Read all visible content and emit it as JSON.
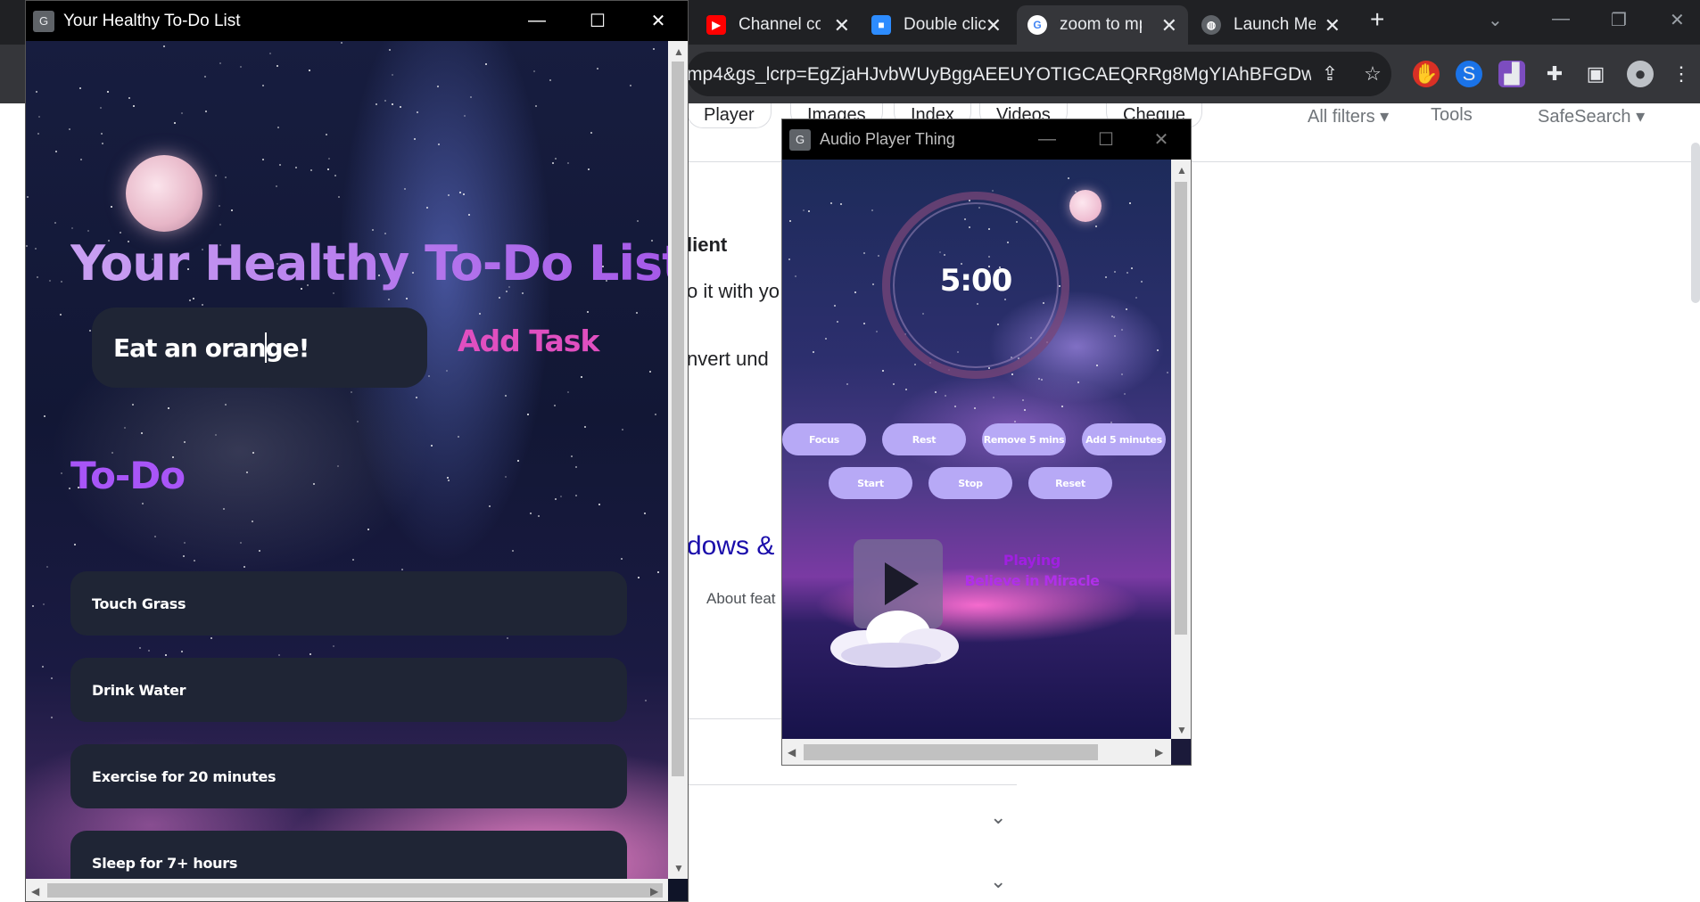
{
  "browser": {
    "tabs": [
      {
        "title": "Channel co",
        "icon": "youtube-icon",
        "color": "#ff0000"
      },
      {
        "title": "Double clic",
        "icon": "zoom-icon",
        "color": "#2d8cff"
      },
      {
        "title": "zoom to mp",
        "icon": "google-icon",
        "color": "#ffffff"
      },
      {
        "title": "Launch Med",
        "icon": "globe-icon",
        "color": "#9aa0a6"
      }
    ],
    "new_tab": "+",
    "address": "mp4&gs_lcrp=EgZjaHJvbWUyBggAEEUYOTIGCAEQRRg8MgYIAhBFGDwy...",
    "filters": [
      "Player",
      "Images",
      "Index",
      "Videos",
      "Cheque"
    ],
    "all_filters": "All filters",
    "tools": "Tools",
    "safesearch": "SafeSearch",
    "bg_snippets": {
      "line1": "lient",
      "line2": "o it with yo",
      "line3": "nvert und",
      "heading": "dows &",
      "about": "About feat"
    }
  },
  "todo_window": {
    "title": "Your Healthy To-Do List",
    "heading": "Your Healthy To-Do List",
    "input_value": "Eat an orange!",
    "add_button": "Add Task",
    "section_title": "To-Do",
    "tasks": [
      "Touch Grass",
      "Drink Water",
      "Exercise for 20 minutes",
      "Sleep for 7+ hours"
    ]
  },
  "audio_window": {
    "title": "Audio Player Thing",
    "timer": "5:00",
    "buttons_row1": [
      "Focus",
      "Rest",
      "Remove 5 mins",
      "Add 5 minutes"
    ],
    "buttons_row2": [
      "Start",
      "Stop",
      "Reset"
    ],
    "status": "Playing",
    "song": "Believe in Miracle"
  },
  "colors": {
    "title_gradient_start": "#c9a0f2",
    "title_gradient_end": "#a457e8",
    "add_task": "#e04fc0",
    "todo_heading": "#a855f7",
    "task_bg": "#1f2535",
    "player_button": "#b7a9f6",
    "now_playing": "#b030e8"
  }
}
